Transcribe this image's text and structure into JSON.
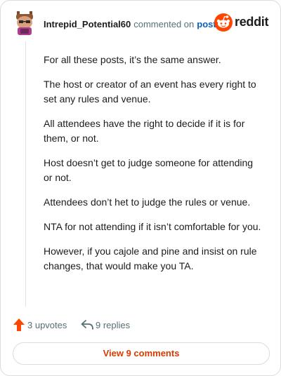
{
  "header": {
    "username": "Intrepid_Potential60",
    "action": "commented on",
    "post_link": "post",
    "brand": "reddit"
  },
  "comment": {
    "paragraphs": [
      "For all these posts, it’s the same answer.",
      "The host or creator of an event has every right to set any rules and venue.",
      "All attendees have the right to decide if it is for them, or not.",
      "Host doesn’t get to judge someone for attending or not.",
      "Attendees don’t het to judge the rules or venue.",
      "NTA for not attending if it isn’t comfortable for you.",
      "However, if you cajole and pine and insist on rule changes, that would make you TA."
    ]
  },
  "actions": {
    "upvotes": "3 upvotes",
    "replies": "9 replies"
  },
  "view_comments": "View 9 comments",
  "colors": {
    "accent": "#d93a00",
    "upvote": "#ff4500",
    "link": "#0a5fbf",
    "muted": "#576f76"
  },
  "icons": {
    "avatar": "avatar",
    "brand": "reddit-logo-icon",
    "upvote": "upvote-arrow-icon",
    "reply": "reply-arrow-icon"
  }
}
